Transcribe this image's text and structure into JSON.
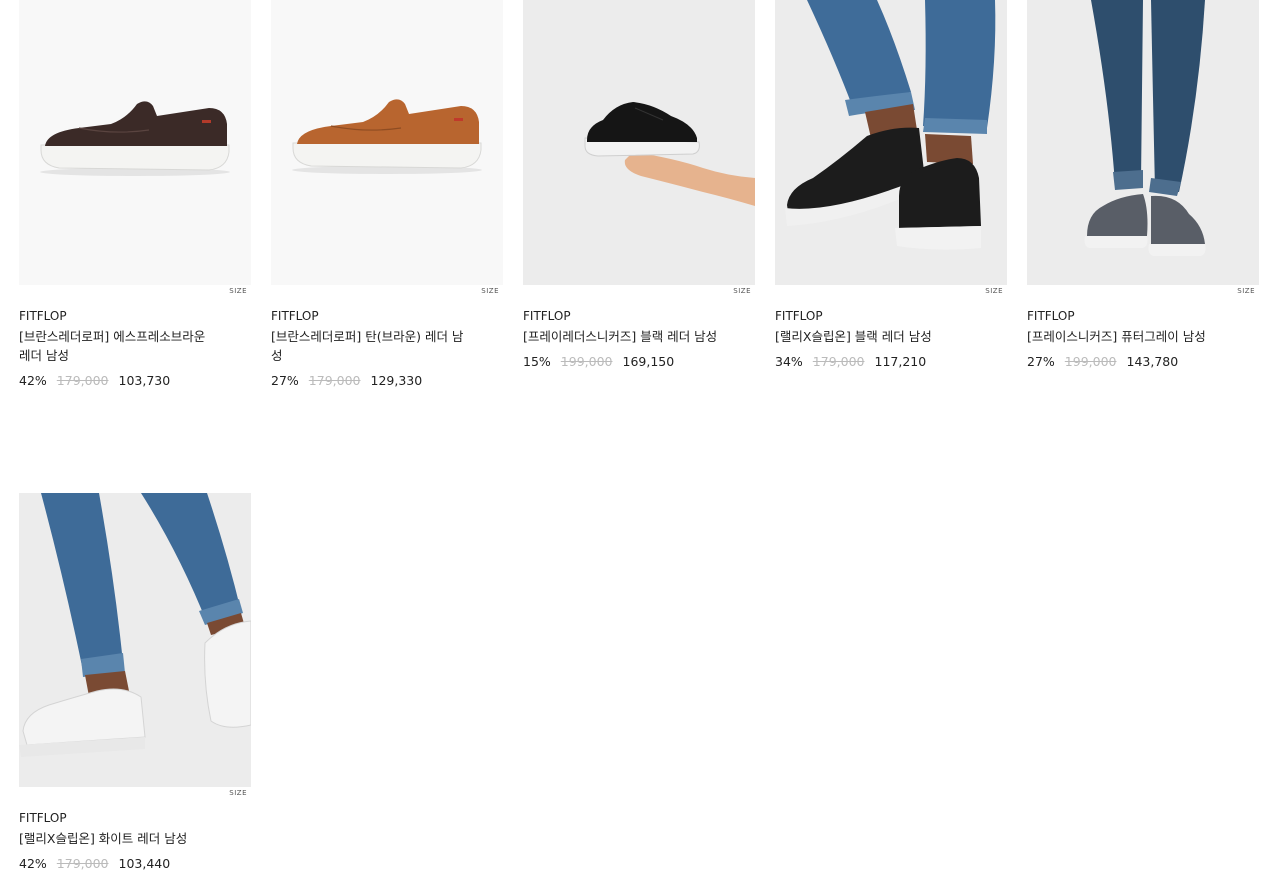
{
  "size_label": "SIZE",
  "products": [
    {
      "brand": "FITFLOP",
      "name": "[브란스레더로퍼] 에스프레소브라운 레더 남성",
      "rate": "42%",
      "original_price": "179,000",
      "sale_price": "103,730",
      "image": "espresso-leather-loafer"
    },
    {
      "brand": "FITFLOP",
      "name": "[브란스레더로퍼] 탄(브라운) 레더 남성",
      "rate": "27%",
      "original_price": "179,000",
      "sale_price": "129,330",
      "image": "tan-leather-loafer"
    },
    {
      "brand": "FITFLOP",
      "name": "[프레이레더스니커즈] 블랙 레더 남성",
      "rate": "15%",
      "original_price": "199,000",
      "sale_price": "169,150",
      "image": "black-leather-sneaker-in-hand"
    },
    {
      "brand": "FITFLOP",
      "name": "[랠리X슬립온] 블랙 레더 남성",
      "rate": "34%",
      "original_price": "179,000",
      "sale_price": "117,210",
      "image": "black-slip-on-worn"
    },
    {
      "brand": "FITFLOP",
      "name": "[프레이스니커즈] 퓨터그레이 남성",
      "rate": "27%",
      "original_price": "199,000",
      "sale_price": "143,780",
      "image": "grey-sneaker-worn"
    },
    {
      "brand": "FITFLOP",
      "name": "[랠리X슬립온] 화이트 레더 남성",
      "rate": "42%",
      "original_price": "179,000",
      "sale_price": "103,440",
      "image": "white-slip-on-worn"
    }
  ]
}
